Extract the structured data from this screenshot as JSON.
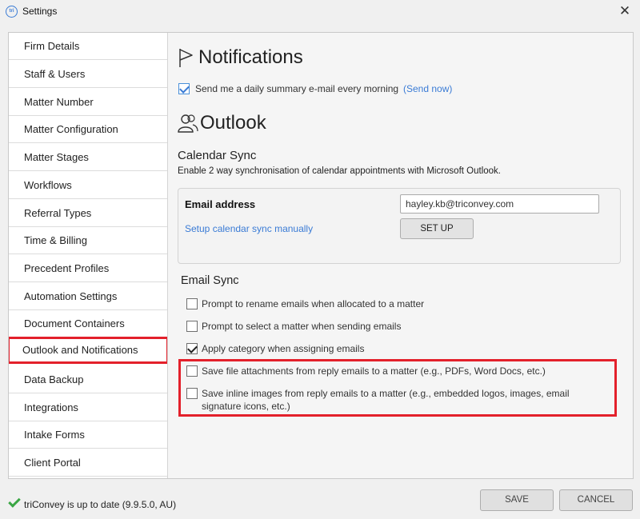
{
  "window": {
    "title": "Settings",
    "app_icon_text": "tri",
    "close_glyph": "✕"
  },
  "sidebar": {
    "items": [
      {
        "label": "Firm Details"
      },
      {
        "label": "Staff & Users"
      },
      {
        "label": "Matter Number"
      },
      {
        "label": "Matter Configuration"
      },
      {
        "label": "Matter Stages"
      },
      {
        "label": "Workflows"
      },
      {
        "label": "Referral Types"
      },
      {
        "label": "Time & Billing"
      },
      {
        "label": "Precedent Profiles"
      },
      {
        "label": "Automation Settings"
      },
      {
        "label": "Document Containers"
      },
      {
        "label": "Outlook and Notifications"
      },
      {
        "label": "Data Backup"
      },
      {
        "label": "Integrations"
      },
      {
        "label": "Intake Forms"
      },
      {
        "label": "Client Portal"
      }
    ],
    "active_index": 11
  },
  "notifications": {
    "title": "Notifications",
    "icon": "flag-icon",
    "daily_summary_label": "Send me a daily summary e-mail every morning",
    "daily_summary_checked": true,
    "send_now_link": "(Send now)"
  },
  "outlook": {
    "title": "Outlook",
    "icon": "users-icon",
    "calendar_sync": {
      "title": "Calendar Sync",
      "description": "Enable 2 way synchronisation of calendar appointments with Microsoft Outlook.",
      "email_label": "Email address",
      "email_value": "hayley.kb@triconvey.com",
      "setup_link": "Setup calendar sync manually",
      "setup_button": "SET UP"
    },
    "email_sync": {
      "title": "Email Sync",
      "options": [
        {
          "label": "Prompt to rename emails when allocated to a matter",
          "checked": false
        },
        {
          "label": "Prompt to select a matter when sending emails",
          "checked": false
        },
        {
          "label": "Apply category when assigning emails",
          "checked": true
        },
        {
          "label": "Save file attachments from reply emails to a matter (e.g., PDFs, Word Docs, etc.)",
          "checked": false
        },
        {
          "label": "Save inline images from reply emails to a matter (e.g., embedded logos, images, email signature icons, etc.)",
          "checked": false
        }
      ]
    }
  },
  "footer": {
    "status_text": "triConvey is up to date (9.9.5.0, AU)",
    "save_button": "SAVE",
    "cancel_button": "CANCEL"
  },
  "colors": {
    "highlight": "#e3202b",
    "link": "#3a7bd5",
    "status_ok": "#3aa644"
  }
}
